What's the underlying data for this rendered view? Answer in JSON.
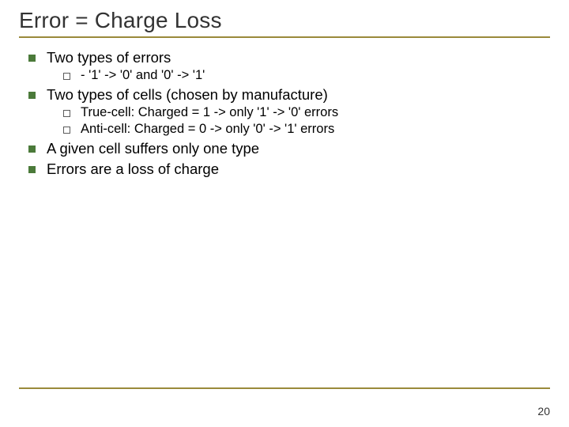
{
  "title": "Error = Charge Loss",
  "items": [
    {
      "text": "Two types of errors",
      "sub": [
        "- '1' -> '0' and '0' -> '1'"
      ]
    },
    {
      "text": "Two types of cells (chosen by manufacture)",
      "sub": [
        "True-cell: Charged = 1 -> only '1' -> '0' errors",
        "Anti-cell: Charged = 0 -> only '0' -> '1' errors"
      ]
    },
    {
      "text": "A given cell suffers only one type",
      "sub": []
    },
    {
      "text": "Errors are a loss of charge",
      "sub": []
    }
  ],
  "page_number": "20"
}
